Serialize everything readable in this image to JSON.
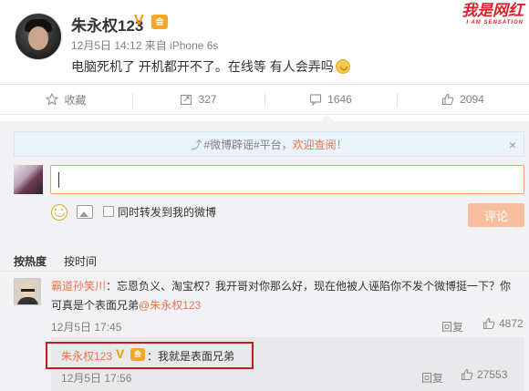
{
  "post": {
    "username": "朱永权123",
    "verified_mark": "V",
    "vip_mark": "会",
    "meta": "12月5日 14:12 来自 iPhone 6s",
    "text": "电脑死机了 开机都开不了。在线等 有人会弄吗"
  },
  "watermark": {
    "text": "我是网红",
    "sub": "I AM SENSATION"
  },
  "actions": {
    "favorite": "收藏",
    "repost": "327",
    "comment": "1646",
    "like": "2094"
  },
  "notice": {
    "tag": "#微博辟谣#平台，",
    "highlight": "欢迎查阅！",
    "close": "×"
  },
  "composer": {
    "repost_checkbox_label": "同时转发到我的微博",
    "submit": "评论"
  },
  "sort": {
    "hot": "按热度",
    "time": "按时间"
  },
  "comment": {
    "user": "霸道孙笑川",
    "text": "：忘恩负义、淘宝权？我开哥对你那么好，现在他被人诬陷你不发个微博挺一下？你可真是个表面兄弟",
    "at_user": "@朱永权123",
    "time": "12月5日 17:45",
    "reply_label": "回复",
    "likes": "4872"
  },
  "reply": {
    "user": "朱永权123",
    "v_mark": "V",
    "vip_mark": "会",
    "text": "：我就是表面兄弟",
    "time": "12月5日 17:56",
    "reply_label": "回复",
    "likes": "27553"
  },
  "colors": {
    "accent": "#eb7350",
    "highlight_border": "#c8191f",
    "submit_bg": "#f7bf9f"
  },
  "icons": [
    "star-icon",
    "repost-icon",
    "comment-icon",
    "thumbs-up-icon",
    "emoji-icon",
    "image-icon",
    "trend-icon",
    "close-icon"
  ]
}
